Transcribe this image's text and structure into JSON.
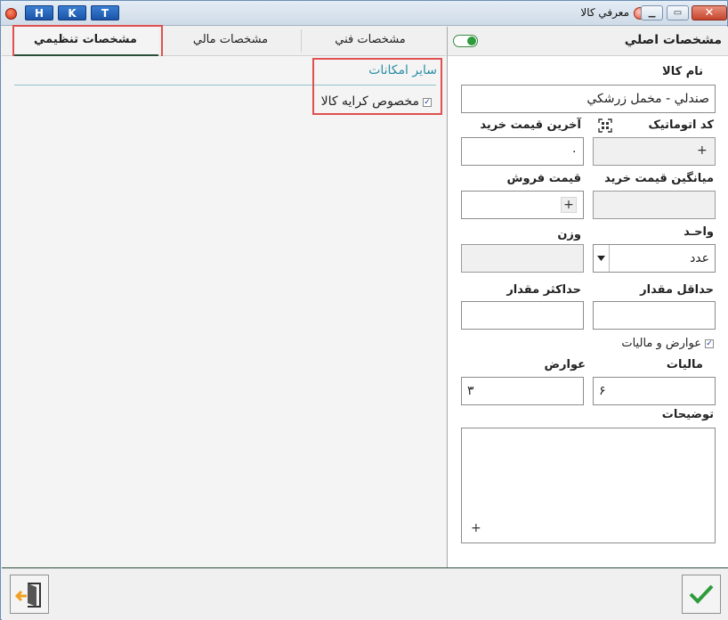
{
  "window": {
    "title": "معرفي کالا",
    "hkt_buttons": [
      "H",
      "K",
      "T"
    ],
    "minimize_glyph": "▁",
    "maximize_glyph": "▭",
    "close_glyph": "✕"
  },
  "main_section": {
    "title": "مشخصات اصلي",
    "toggle_on": true,
    "fields": {
      "name_label": "نام کالا",
      "name_value": "صندلي - مخمل زرشکي",
      "auto_code_label": "کد اتوماتيک",
      "auto_code_value": "",
      "last_purchase_price_label": "آخرين قيمت خريد",
      "last_purchase_price_value": "۰",
      "avg_purchase_price_label": "ميانگين قيمت خريد",
      "avg_purchase_price_value": "",
      "sale_price_label": "قيمت فروش",
      "sale_price_value": "",
      "unit_label": "واحـد",
      "unit_value": "عدد",
      "weight_label": "وزن",
      "weight_value": "",
      "min_qty_label": "حداقل مقدار",
      "min_qty_value": "",
      "max_qty_label": "حداکثر مقدار",
      "max_qty_value": "",
      "taxes_checkbox_label": "عوارض و ماليات",
      "taxes_checked": true,
      "tax_label": "ماليات",
      "tax_value": "۶",
      "duty_label": "عوارض",
      "duty_value": "۳",
      "description_label": "توضيحات",
      "description_value": "",
      "plus_glyph": "+"
    }
  },
  "tabs": [
    {
      "label": "مشخصات فني",
      "active": false
    },
    {
      "label": "مشخصات مالي",
      "active": false
    },
    {
      "label": "مشخصات تنظيمي",
      "active": true
    }
  ],
  "settings_tab": {
    "section_title": "ساير امکانات",
    "rental_checkbox_label": "مخصوص کرايه کالا",
    "rental_checked": true
  },
  "colors": {
    "accent_green": "#2e9c3c",
    "section_teal": "#2c8fa3",
    "highlight_red": "#e05050",
    "exit_orange": "#f0a020"
  }
}
